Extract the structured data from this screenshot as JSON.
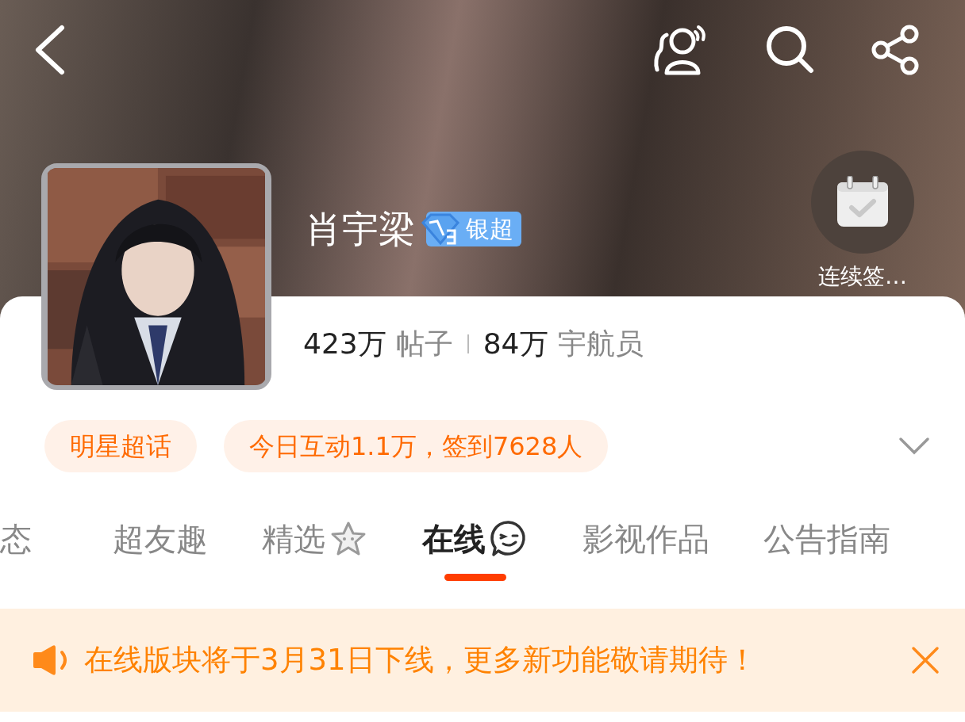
{
  "header": {
    "name": "肖宇梁",
    "badge": "银超",
    "checkin_label": "连续签…"
  },
  "stats": [
    {
      "text": "423万",
      "kind": "number"
    },
    {
      "text": "帖子",
      "kind": "unit"
    },
    {
      "text": "84万",
      "kind": "number"
    },
    {
      "text": "宇航员",
      "kind": "unit"
    }
  ],
  "tags": [
    {
      "label": "明星超话"
    },
    {
      "label": "今日互动1.1万，签到7628人"
    }
  ],
  "tabs": [
    {
      "label": "态",
      "selected": false,
      "kind": "plain"
    },
    {
      "label": "超友趣",
      "selected": false,
      "kind": "plain"
    },
    {
      "label": "精选",
      "selected": false,
      "kind": "star"
    },
    {
      "label": "在线",
      "selected": true,
      "kind": "emoji"
    },
    {
      "label": "影视作品",
      "selected": false,
      "kind": "plain"
    },
    {
      "label": "公告指南",
      "selected": false,
      "kind": "plain"
    }
  ],
  "notice": {
    "text": "在线版块将于3月31日下线，更多新功能敬请期待！"
  }
}
